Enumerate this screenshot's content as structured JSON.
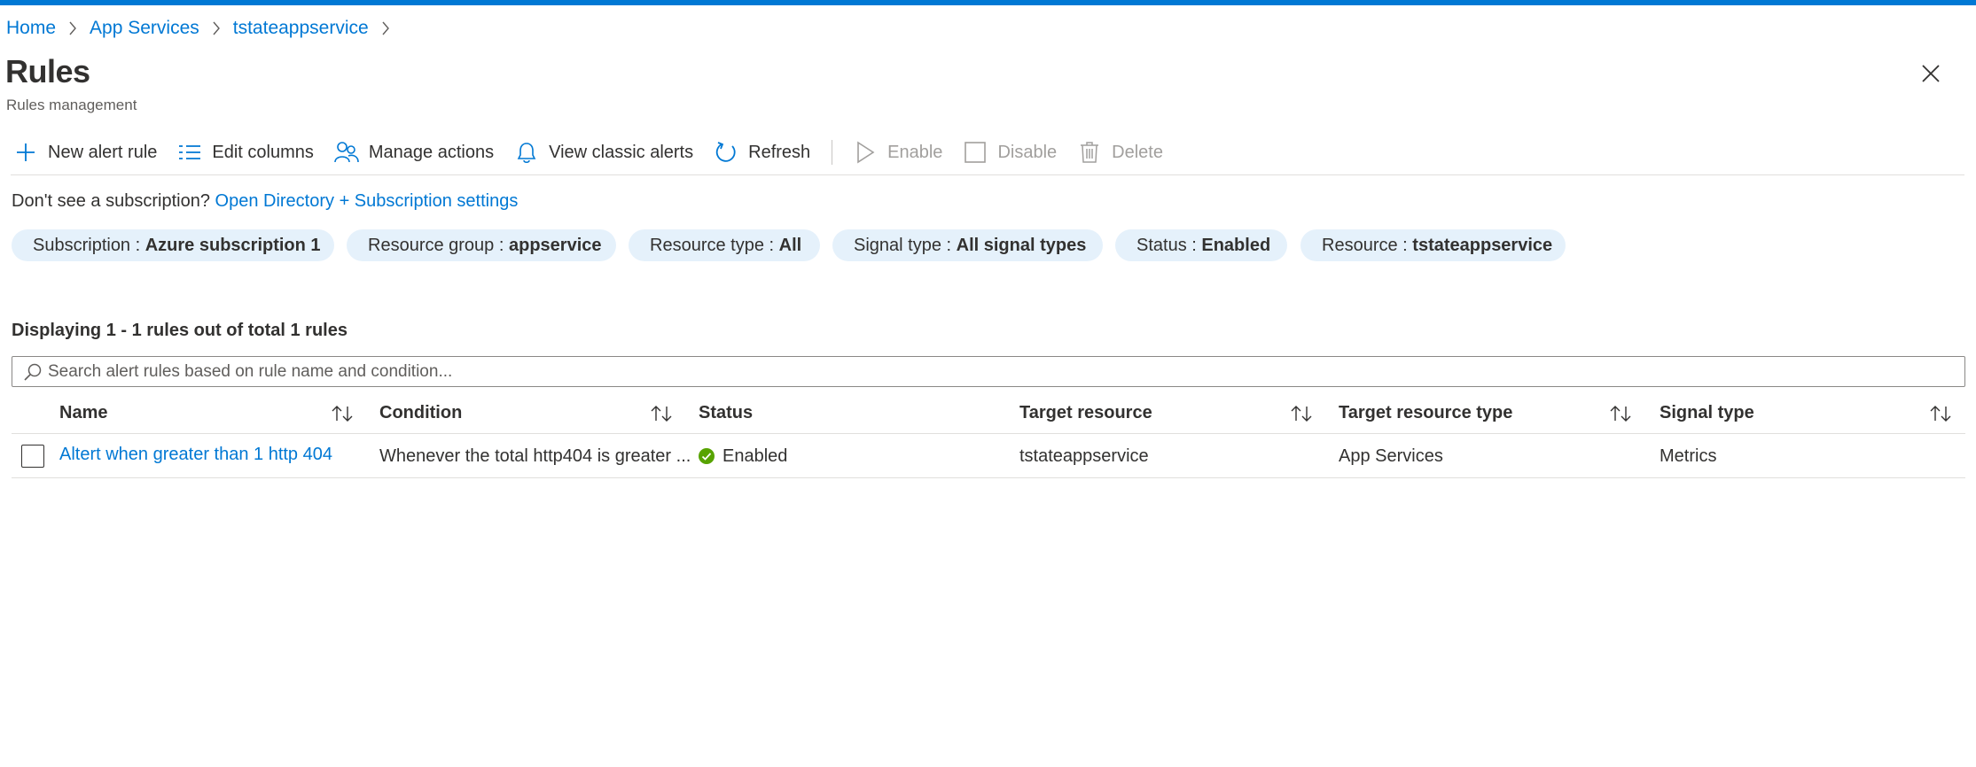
{
  "colors": {
    "accent": "#0078d4",
    "success": "#57a300",
    "pill_bg": "#e5f1fb"
  },
  "breadcrumb": [
    "Home",
    "App Services",
    "tstateappservice"
  ],
  "page": {
    "title": "Rules",
    "subtitle": "Rules management"
  },
  "toolbar": {
    "new_alert_rule": "New alert rule",
    "edit_columns": "Edit columns",
    "manage_actions": "Manage actions",
    "view_classic_alerts": "View classic alerts",
    "refresh": "Refresh",
    "enable": "Enable",
    "disable": "Disable",
    "delete": "Delete"
  },
  "notice": {
    "text": "Don't see a subscription?",
    "link": "Open Directory + Subscription settings"
  },
  "filters": [
    {
      "label": "Subscription : ",
      "value": "Azure subscription 1"
    },
    {
      "label": "Resource group : ",
      "value": "appservice"
    },
    {
      "label": "Resource type : ",
      "value": "All"
    },
    {
      "label": "Signal type : ",
      "value": "All signal types"
    },
    {
      "label": "Status : ",
      "value": "Enabled"
    },
    {
      "label": "Resource : ",
      "value": "tstateappservice"
    }
  ],
  "results": {
    "summary": "Displaying 1 - 1 rules out of total 1 rules"
  },
  "search": {
    "placeholder": "Search alert rules based on rule name and condition..."
  },
  "table": {
    "columns": [
      "Name",
      "Condition",
      "Status",
      "Target resource",
      "Target resource type",
      "Signal type"
    ],
    "rows": [
      {
        "name": "Altert when greater than 1 http 404",
        "condition": "Whenever the total http404 is greater ...",
        "status": "Enabled",
        "target_resource": "tstateappservice",
        "target_resource_type": "App Services",
        "signal_type": "Metrics"
      }
    ]
  }
}
